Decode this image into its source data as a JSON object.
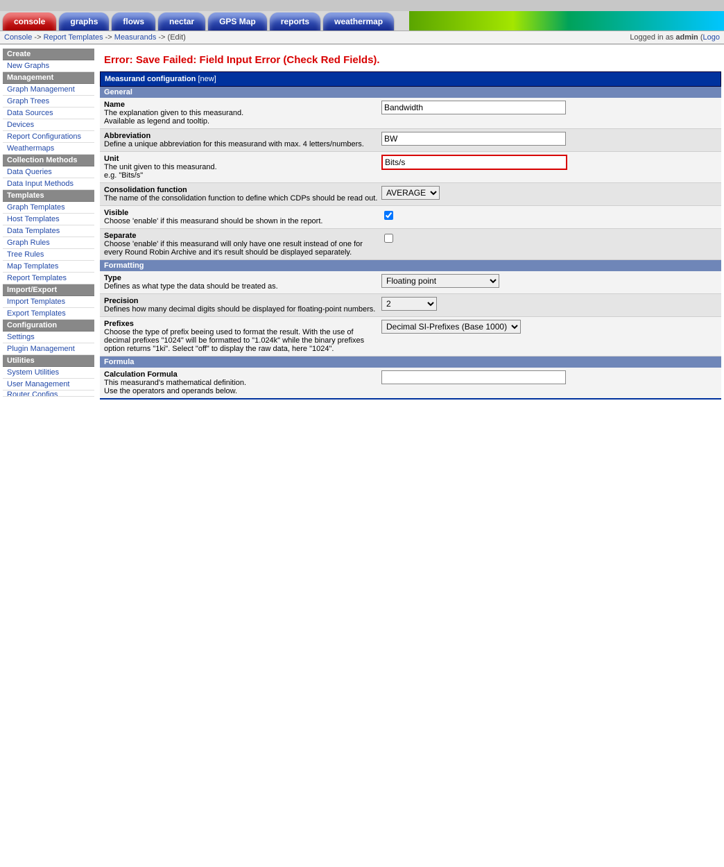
{
  "tabs": [
    "console",
    "graphs",
    "flows",
    "nectar",
    "GPS Map",
    "reports",
    "weathermap"
  ],
  "breadcrumb": {
    "parts": [
      "Console",
      "Report Templates",
      "Measurands"
    ],
    "tail": "(Edit)",
    "sep": " -> "
  },
  "login": {
    "prefix": "Logged in as ",
    "user": "admin",
    "open": " (",
    "link": "Logo"
  },
  "side": {
    "Create": [
      "New Graphs"
    ],
    "Management": [
      "Graph Management",
      "Graph Trees",
      "Data Sources",
      "Devices",
      "Report Configurations",
      "Weathermaps"
    ],
    "Collection Methods": [
      "Data Queries",
      "Data Input Methods"
    ],
    "Templates": [
      "Graph Templates",
      "Host Templates",
      "Data Templates",
      "Graph Rules",
      "Tree Rules",
      "Map Templates",
      "Report Templates"
    ],
    "Import/Export": [
      "Import Templates",
      "Export Templates"
    ],
    "Configuration": [
      "Settings",
      "Plugin Management"
    ],
    "Utilities": [
      "System Utilities",
      "User Management",
      "Router Configs"
    ]
  },
  "error": "Error: Save Failed: Field Input Error (Check Red Fields).",
  "panel": {
    "title": "Measurand configuration",
    "sub": "[new]"
  },
  "sections": {
    "general": "General",
    "formatting": "Formatting",
    "formula": "Formula"
  },
  "f": {
    "name": {
      "label": "Name",
      "desc": "The explanation given to this measurand.\nAvailable as legend and tooltip.",
      "value": "Bandwidth"
    },
    "abbr": {
      "label": "Abbreviation",
      "desc": "Define a unique abbreviation for this measurand with max. 4 letters/numbers.",
      "value": "BW"
    },
    "unit": {
      "label": "Unit",
      "desc": "The unit given to this measurand.\ne.g. \"Bits/s\"",
      "value": "Bits/s"
    },
    "cf": {
      "label": "Consolidation function",
      "desc": "The name of the consolidation function to define which CDPs should be read out.",
      "value": "AVERAGE"
    },
    "visible": {
      "label": "Visible",
      "desc": "Choose 'enable' if this measurand should be shown in the report."
    },
    "sep": {
      "label": "Separate",
      "desc": "Choose 'enable' if this measurand will only have one result instead of one for every Round Robin Archive and it's result should be displayed separately."
    },
    "type": {
      "label": "Type",
      "desc": "Defines as what type the data should be treated as.",
      "value": "Floating point"
    },
    "prec": {
      "label": "Precision",
      "desc": "Defines how many decimal digits should be displayed for floating-point numbers.",
      "value": "2"
    },
    "prefix": {
      "label": "Prefixes",
      "desc": "Choose the type of prefix beeing used to format the result. With the use of decimal prefixes \"1024\" will be formatted to \"1.024k\" while the binary prefixes option returns \"1ki\". Select \"off\" to display the raw data, here \"1024\".",
      "value": "Decimal SI-Prefixes (Base 1000)"
    },
    "calc": {
      "label": "Calculation Formula",
      "desc": "This measurand's mathematical definition.\nUse the operators and operands below.",
      "value": ""
    }
  }
}
